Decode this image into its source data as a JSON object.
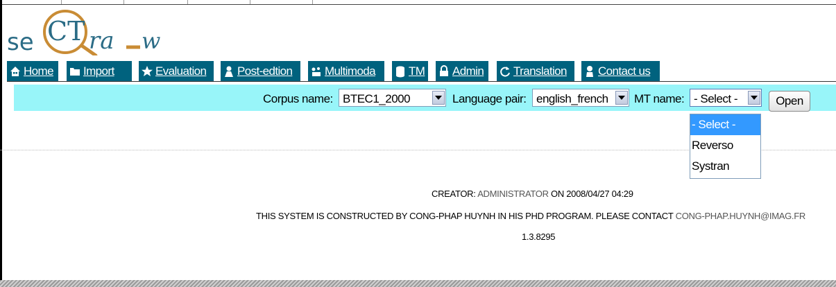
{
  "nav": {
    "home": "Home",
    "import": "Import",
    "evaluation": "Evaluation",
    "postedition": "Post-edtion",
    "multimodal": "Multimoda",
    "tm": "TM",
    "admin": "Admin",
    "translation": "Translation",
    "contact": "Contact us"
  },
  "toolbar": {
    "corpus_label": "Corpus name:",
    "corpus_value": "BTEC1_2000",
    "language_label": "Language pair:",
    "language_value": "english_french",
    "mt_label": "MT name:",
    "mt_value": "- Select -",
    "open_label": "Open",
    "mt_options": [
      "- Select -",
      "Reverso",
      "Systran"
    ]
  },
  "footer": {
    "creator_label": "CREATOR:",
    "creator_name": "ADMINISTRATOR",
    "creator_on": "ON 2008/04/27 04:29",
    "notice": "THIS SYSTEM IS CONSTRUCTED BY CONG-PHAP HUYNH IN HIS PHD PROGRAM. PLEASE CONTACT",
    "email": "CONG-PHAP.HUYNH@IMAG.FR",
    "version": "1.3.8295"
  },
  "colors": {
    "nav_bg": "#00627e",
    "toolbar_bg": "#98f5f9",
    "selection": "#3399ff",
    "logo_primary": "#2b6c86",
    "logo_accent": "#c98c35"
  }
}
